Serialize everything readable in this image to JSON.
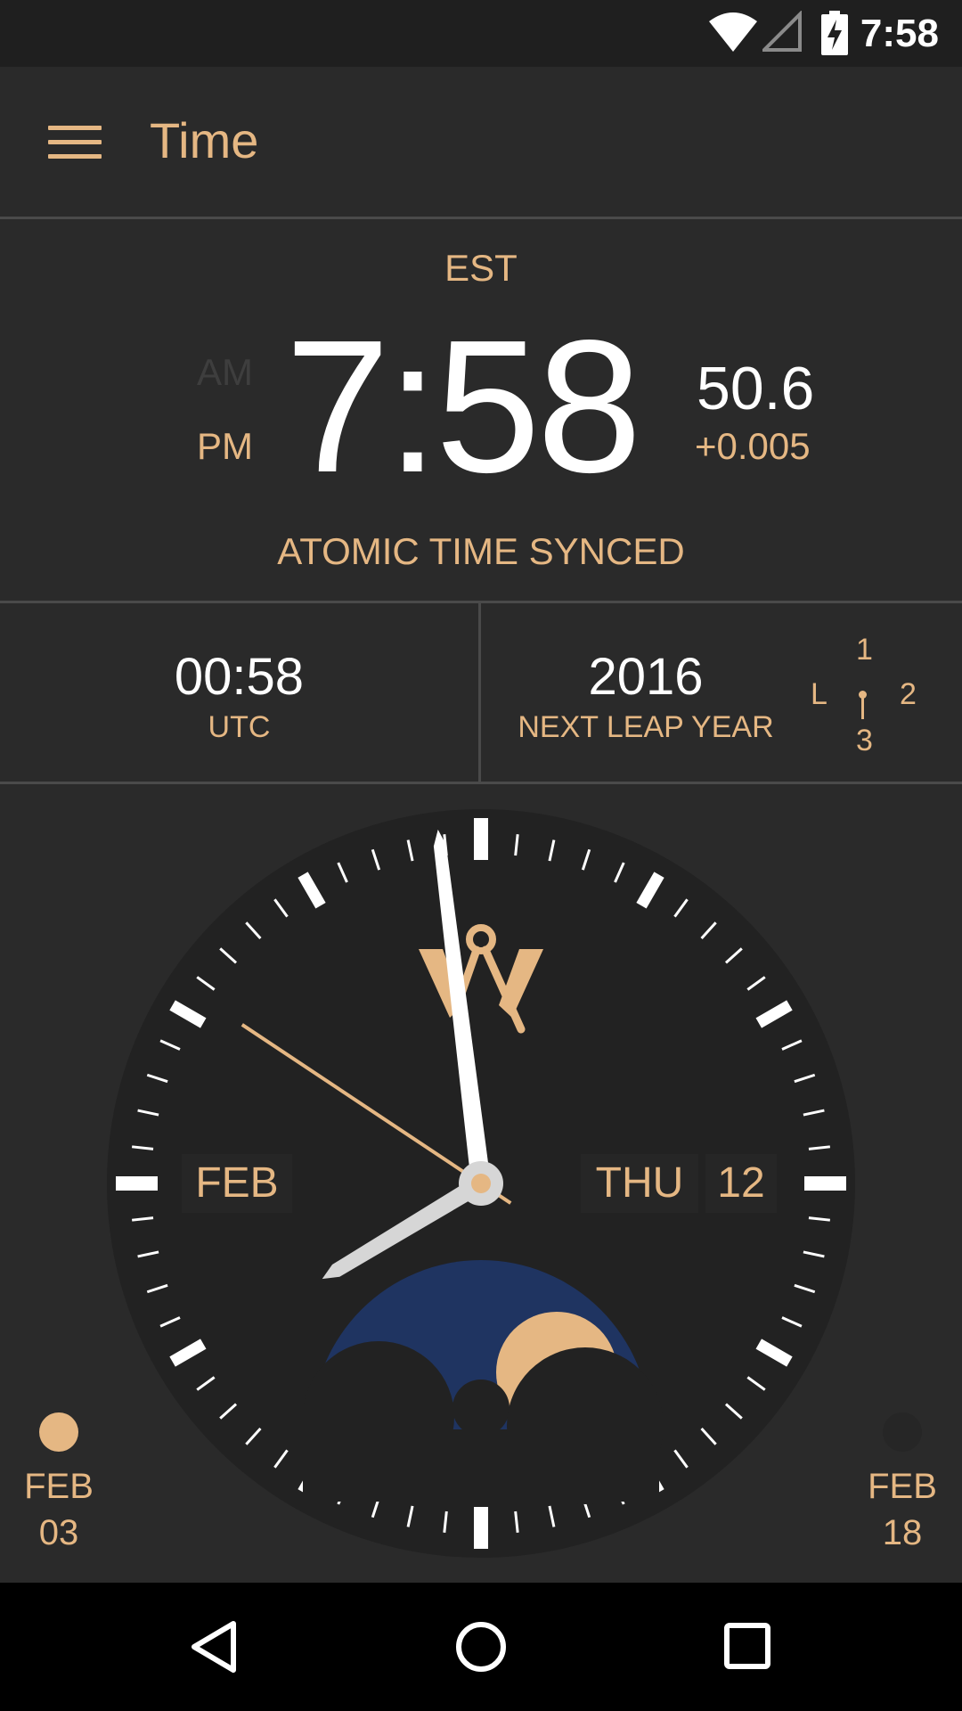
{
  "status_bar": {
    "time": "7:58",
    "icons": [
      "wifi-icon",
      "signal-icon",
      "battery-charging-icon"
    ]
  },
  "app_bar": {
    "menu_icon": "hamburger-menu-icon",
    "title": "Time"
  },
  "local_time": {
    "timezone": "EST",
    "am_label": "AM",
    "pm_label": "PM",
    "active_period": "PM",
    "time": "7:58",
    "seconds": "50.6",
    "offset": "+0.005",
    "sync_status": "ATOMIC TIME SYNCED"
  },
  "utc": {
    "value": "00:58",
    "label": "UTC"
  },
  "leap_year": {
    "value": "2016",
    "label": "NEXT LEAP YEAR",
    "cycle_labels": {
      "top": "1",
      "right": "2",
      "bottom": "3",
      "left": "L"
    }
  },
  "clock": {
    "hour": 7,
    "minute": 58,
    "second": 50.6,
    "logo_icon": "compass-logo-icon",
    "month": "FEB",
    "weekday": "THU",
    "day": "12",
    "moon_phase_icon": "moon-phase-icon"
  },
  "moon_dates": {
    "left": {
      "month": "FEB",
      "day": "03",
      "icon": "full-moon-icon"
    },
    "right": {
      "month": "FEB",
      "day": "18",
      "icon": "new-moon-icon"
    }
  },
  "nav_bar": {
    "back": "back-icon",
    "home": "home-icon",
    "recents": "recents-icon"
  },
  "colors": {
    "accent": "#e5b783",
    "background": "#2a2a2a",
    "clock_face": "#222222",
    "moon_sky": "#1f3461",
    "text_primary": "#ffffff"
  }
}
